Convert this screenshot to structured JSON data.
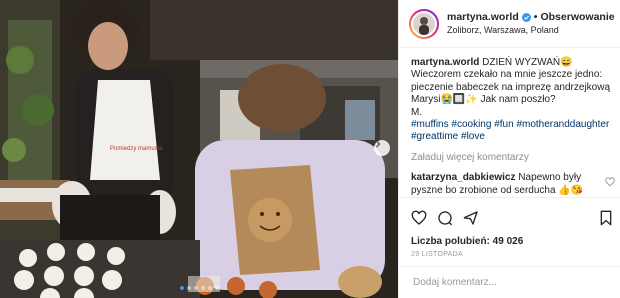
{
  "header": {
    "username": "martyna.world",
    "follow_label": "Obserwowanie",
    "location": "Zoliborz, Warszawa, Poland"
  },
  "photo": {
    "apron_text": "Pomiedzy mamusia"
  },
  "caption": {
    "username": "martyna.world",
    "text": "DZIEŃ WYZWAŃ😄 Wieczorem czekało na mnie jeszcze jedno: pieczenie babeczek na imprezę andrzejkową Marysi😭🔲✨ Jak nam poszło?",
    "signature": "M.",
    "hashtags": "#muffins #cooking #fun #motheranddaughter #greattime #love"
  },
  "load_more_label": "Załaduj więcej komentarzy",
  "comments": [
    {
      "username": "katarzyna_dabkiewicz",
      "text": "Napewno były pyszne bo zrobione od serducha 👍😘"
    }
  ],
  "likes_label": "Liczba polubień: 49 026",
  "date_label": "29 LISTOPADA",
  "add_comment_placeholder": "Dodaj komentarz...",
  "carousel": {
    "slides": 6,
    "active": 0
  },
  "colors": {
    "link": "#003569",
    "accent": "#3897f0",
    "verified": "#3897f0"
  }
}
